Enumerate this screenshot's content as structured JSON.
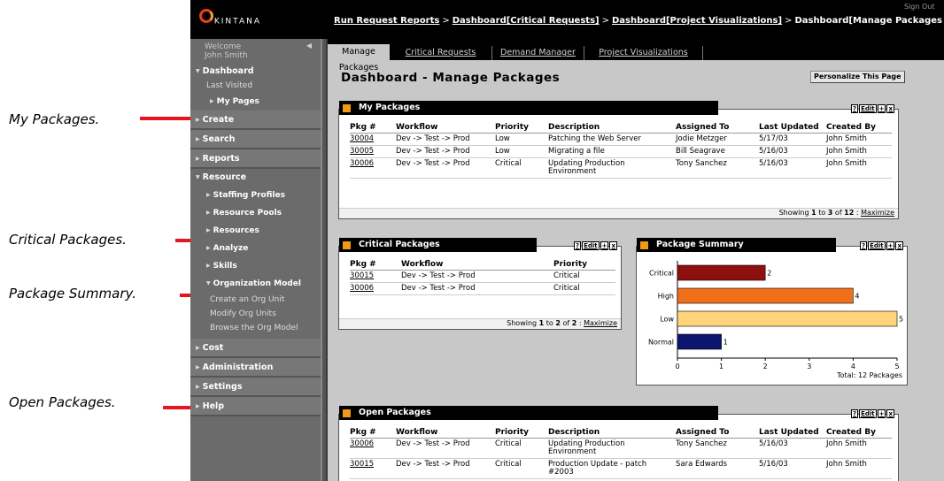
{
  "callouts": {
    "my_packages": "My Packages.",
    "critical_packages": "Critical Packages.",
    "package_summary": "Package Summary.",
    "open_packages": "Open Packages."
  },
  "app": {
    "logo_text": "KINTANA",
    "sign_out": "Sign Out",
    "breadcrumb": {
      "items": [
        "Run Request Reports",
        "Dashboard[Critical Requests]",
        "Dashboard[Project Visualizations]"
      ],
      "current": "Dashboard[Manage Packages"
    },
    "tabs": [
      "Manage Packages",
      "Critical Requests",
      "Demand Manager",
      "Project Visualizations"
    ],
    "page_title": "Dashboard - Manage Packages",
    "personalize_label": "Personalize This Page"
  },
  "sidebar": {
    "welcome_line1": "Welcome",
    "welcome_line2": "John Smith",
    "items": [
      {
        "label": "Dashboard"
      },
      {
        "label": "Last Visited"
      },
      {
        "label": "My Pages"
      },
      {
        "label": "Create"
      },
      {
        "label": "Search"
      },
      {
        "label": "Reports"
      },
      {
        "label": "Resource"
      },
      {
        "label": "Staffing Profiles"
      },
      {
        "label": "Resource Pools"
      },
      {
        "label": "Resources"
      },
      {
        "label": "Analyze"
      },
      {
        "label": "Skills"
      },
      {
        "label": "Organization Model"
      },
      {
        "label": "Create an Org Unit"
      },
      {
        "label": "Modify Org Units"
      },
      {
        "label": "Browse the Org Model"
      },
      {
        "label": "Cost"
      },
      {
        "label": "Administration"
      },
      {
        "label": "Settings"
      },
      {
        "label": "Help"
      }
    ]
  },
  "controls": {
    "help": "?",
    "edit": "Edit",
    "add": "+",
    "close": "x"
  },
  "my_packages": {
    "title": "My Packages",
    "columns": [
      "Pkg #",
      "Workflow",
      "Priority",
      "Description",
      "Assigned To",
      "Last Updated",
      "Created By"
    ],
    "rows": [
      [
        "30004",
        "Dev -> Test -> Prod",
        "Low",
        "Patching the Web Server",
        "Jodie Metzger",
        "5/17/03",
        "John Smith"
      ],
      [
        "30005",
        "Dev -> Test -> Prod",
        "Low",
        "Migrating a file",
        "Bill Seagrave",
        "5/16/03",
        "John Smith"
      ],
      [
        "30006",
        "Dev -> Test -> Prod",
        "Critical",
        "Updating Production Environment",
        "Tony Sanchez",
        "5/16/03",
        "John Smith"
      ]
    ],
    "footer_prefix": "Showing ",
    "footer_range": "1",
    "footer_to": " to ",
    "footer_end": "3",
    "footer_of": " of ",
    "footer_total": "12",
    "footer_sep": " : ",
    "maximize": "Maximize"
  },
  "critical_packages": {
    "title": "Critical Packages",
    "columns": [
      "Pkg #",
      "Workflow",
      "Priority"
    ],
    "rows": [
      [
        "30015",
        "Dev -> Test -> Prod",
        "Critical"
      ],
      [
        "30006",
        "Dev -> Test -> Prod",
        "Critical"
      ]
    ],
    "footer_prefix": "Showing ",
    "footer_range": "1",
    "footer_to": " to ",
    "footer_end": "2",
    "footer_of": " of ",
    "footer_total": "2",
    "footer_sep": " : ",
    "maximize": "Maximize"
  },
  "package_summary": {
    "title": "Package Summary",
    "total_label": "Total: 12 Packages"
  },
  "open_packages": {
    "title": "Open Packages",
    "columns": [
      "Pkg #",
      "Workflow",
      "Priority",
      "Description",
      "Assigned To",
      "Last Updated",
      "Created By"
    ],
    "rows": [
      [
        "30006",
        "Dev -> Test -> Prod",
        "Critical",
        "Updating Production Environment",
        "Tony Sanchez",
        "5/16/03",
        "John Smith"
      ],
      [
        "30015",
        "Dev -> Test -> Prod",
        "Critical",
        "Production Update - patch #2003",
        "Sara Edwards",
        "5/16/03",
        "John Smith"
      ]
    ]
  },
  "chart_data": {
    "type": "bar",
    "orientation": "horizontal",
    "categories": [
      "Critical",
      "High",
      "Low",
      "Normal"
    ],
    "values": [
      2,
      4,
      5,
      1
    ],
    "colors": [
      "#8e0f0f",
      "#f0701a",
      "#ffd47a",
      "#0c1670"
    ],
    "xlim": [
      0,
      5
    ],
    "xticks": [
      0,
      1,
      2,
      3,
      4,
      5
    ],
    "grid": false
  }
}
